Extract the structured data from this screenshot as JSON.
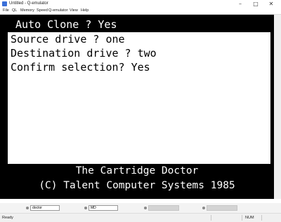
{
  "window": {
    "title": "Untitled - Q-emulator",
    "minimize_glyph": "–",
    "maximize_glyph": "□",
    "close_glyph": "✕"
  },
  "menu": {
    "items": [
      "File",
      "QL",
      "Memory",
      "Speed",
      "Q-emulator",
      "View",
      "Help"
    ]
  },
  "screen": {
    "header": "Auto Clone ? Yes",
    "lines": [
      "Source drive ? one",
      "Destination drive ? two",
      "Confirm selection? Yes"
    ],
    "credit_line_1": "The Cartridge Doctor",
    "credit_line_2": "(C) Talent Computer Systems 1985"
  },
  "drives": [
    {
      "name": "doctor"
    },
    {
      "name": "MD"
    },
    {
      "name": ""
    },
    {
      "name": ""
    }
  ],
  "status": {
    "left": "Ready",
    "num": "NUM"
  }
}
